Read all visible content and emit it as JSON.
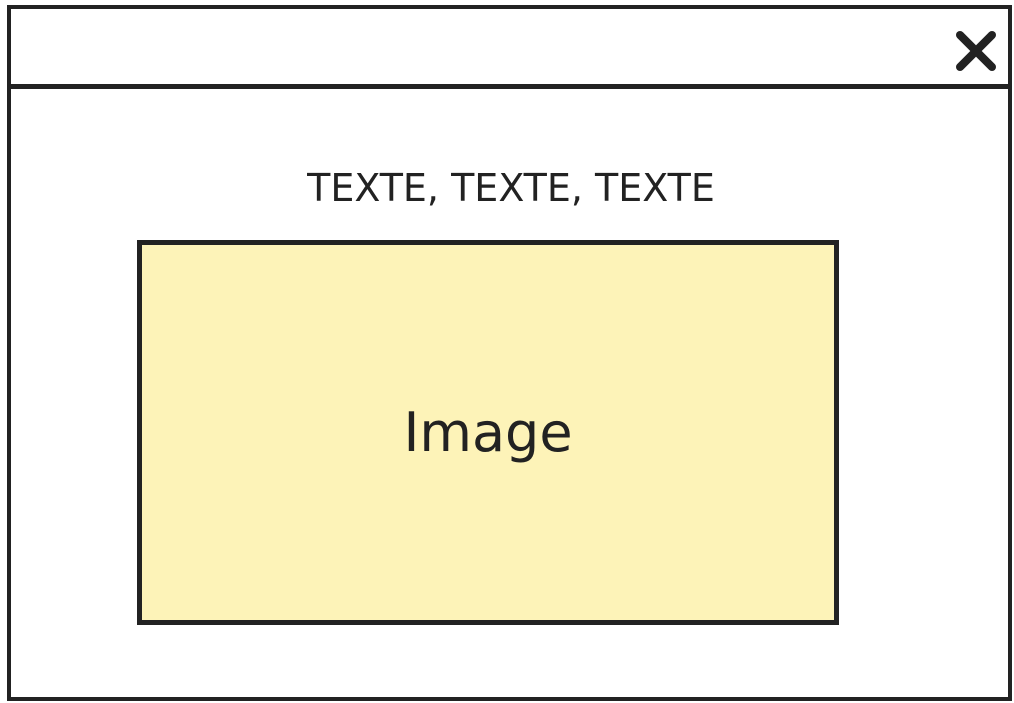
{
  "dialog": {
    "close_icon": "close-icon",
    "caption": "TEXTE, TEXTE, TEXTE",
    "image_placeholder_label": "Image"
  },
  "colors": {
    "border": "#222222",
    "background": "#ffffff",
    "image_fill": "#fdf3b8"
  }
}
